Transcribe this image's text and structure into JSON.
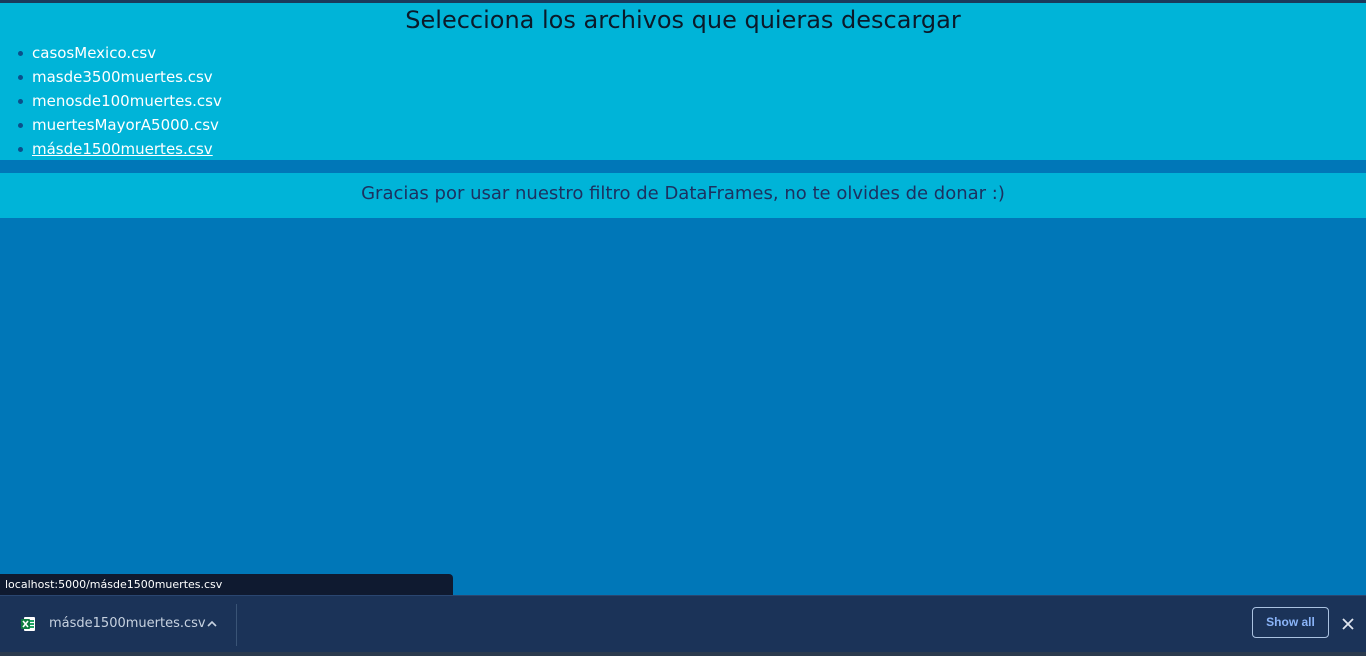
{
  "page": {
    "heading": "Selecciona los archivos que quieras descargar",
    "files": [
      "casosMexico.csv",
      "masde3500muertes.csv",
      "menosde100muertes.csv",
      "muertesMayorA5000.csv",
      "másde1500muertes.csv"
    ],
    "hovered_file_index": 4,
    "footer_message": "Gracias por usar nuestro filtro de DataFrames, no te olvides de donar :)"
  },
  "browser": {
    "status_url": "localhost:5000/másde1500muertes.csv",
    "download_bar": {
      "file_icon": "excel-file-icon",
      "filename": "másde1500muertes.csv",
      "menu_icon": "chevron-up-icon",
      "show_all_label": "Show all",
      "close_icon": "close-icon"
    }
  },
  "colors": {
    "header_bg": "#00b4d8",
    "page_bg": "#0077b8",
    "download_bar_bg": "#1b3358",
    "show_all_text": "#8ab4f8"
  }
}
